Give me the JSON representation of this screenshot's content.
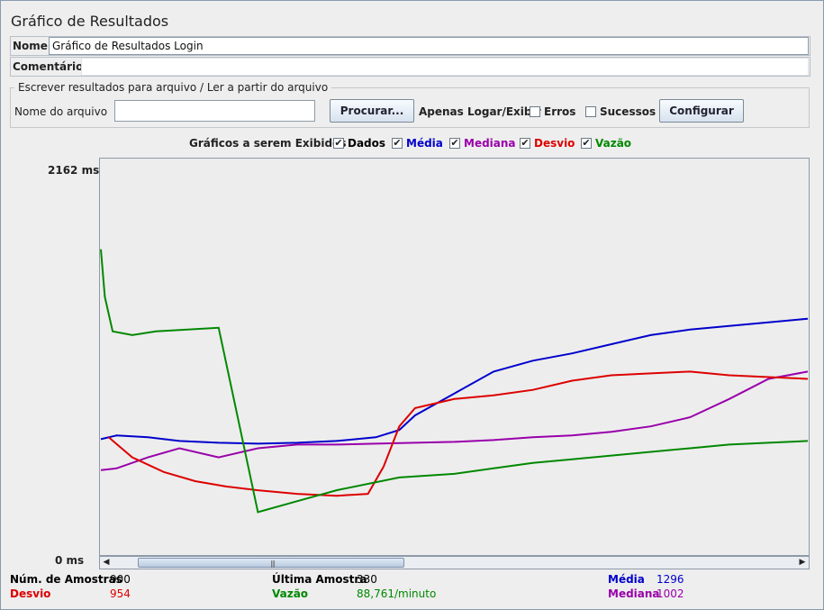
{
  "window": {
    "title": "Gráfico de Resultados"
  },
  "fields": {
    "name_label": "Nome:",
    "name_value": "Gráfico de Resultados Login",
    "comments_label": "Comentários:",
    "comments_value": ""
  },
  "file_group": {
    "title": "Escrever resultados para arquivo / Ler a partir do arquivo",
    "filename_label": "Nome do arquivo",
    "filename_value": "",
    "browse_button": "Procurar...",
    "log_only_label": "Apenas Logar/Exibir",
    "errors_label": "Erros",
    "errors_checked": false,
    "success_label": "Sucessos",
    "success_checked": false,
    "configure_button": "Configurar"
  },
  "graph_options": {
    "title": "Gráficos a serem Exibidos",
    "items": [
      {
        "label": "Dados",
        "checked": true,
        "color": "#000000"
      },
      {
        "label": "Média",
        "checked": true,
        "color": "#0000cc"
      },
      {
        "label": "Mediana",
        "checked": true,
        "color": "#9900aa"
      },
      {
        "label": "Desvio",
        "checked": true,
        "color": "#dd0000"
      },
      {
        "label": "Vazão",
        "checked": true,
        "color": "#008800"
      }
    ]
  },
  "chart_data": {
    "type": "line",
    "y_max_label": "2162 ms",
    "y_min_label": "0 ms",
    "ylim": [
      0,
      2162
    ],
    "x_samples": [
      0,
      900
    ],
    "series": [
      {
        "name": "Média",
        "color": "#0000cc",
        "x": [
          0,
          20,
          60,
          100,
          150,
          200,
          250,
          300,
          350,
          380,
          400,
          450,
          500,
          550,
          600,
          650,
          700,
          750,
          800,
          850,
          900
        ],
        "y": [
          630,
          650,
          640,
          620,
          610,
          605,
          610,
          620,
          640,
          680,
          760,
          880,
          1000,
          1060,
          1100,
          1150,
          1200,
          1230,
          1250,
          1270,
          1290
        ]
      },
      {
        "name": "Mediana",
        "color": "#9900aa",
        "x": [
          0,
          20,
          60,
          100,
          150,
          200,
          250,
          300,
          350,
          400,
          450,
          500,
          550,
          600,
          650,
          700,
          750,
          800,
          850,
          900
        ],
        "y": [
          460,
          470,
          530,
          580,
          530,
          580,
          600,
          600,
          605,
          610,
          615,
          625,
          640,
          650,
          670,
          700,
          750,
          850,
          960,
          1000
        ]
      },
      {
        "name": "Desvio",
        "color": "#dd0000",
        "x": [
          10,
          40,
          80,
          120,
          160,
          200,
          250,
          300,
          340,
          360,
          380,
          400,
          420,
          450,
          500,
          550,
          600,
          650,
          700,
          750,
          800,
          850,
          900
        ],
        "y": [
          640,
          530,
          450,
          400,
          370,
          350,
          330,
          320,
          330,
          480,
          700,
          800,
          820,
          850,
          870,
          900,
          950,
          980,
          990,
          1000,
          980,
          970,
          960
        ]
      },
      {
        "name": "Vazão",
        "color": "#008800",
        "x": [
          0,
          5,
          15,
          40,
          70,
          150,
          200,
          250,
          300,
          380,
          450,
          500,
          550,
          600,
          650,
          700,
          750,
          800,
          850,
          900
        ],
        "y": [
          1670,
          1410,
          1220,
          1200,
          1220,
          1240,
          230,
          290,
          350,
          420,
          440,
          470,
          500,
          520,
          540,
          560,
          580,
          600,
          610,
          620
        ]
      }
    ]
  },
  "stats": {
    "samples_label": "Núm. de Amostras",
    "samples_value": "900",
    "last_label": "Última Amostra",
    "last_value": "330",
    "avg_label": "Média",
    "avg_value": "1296",
    "dev_label": "Desvio",
    "dev_value": "954",
    "throughput_label": "Vazão",
    "throughput_value": "88,761/minuto",
    "median_label": "Mediana",
    "median_value": "1002"
  }
}
